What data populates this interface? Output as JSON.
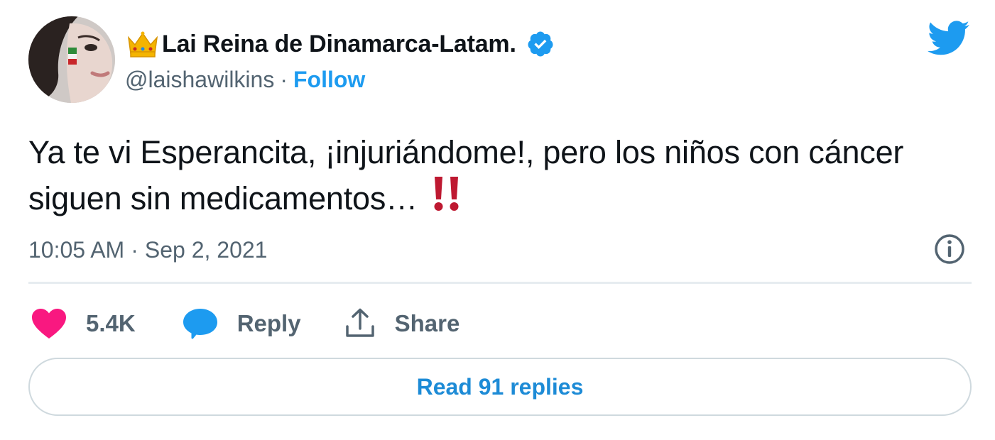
{
  "author": {
    "display_name": "Lai Reina de Dinamarca-Latam.",
    "name_emoji_icon": "crown-icon",
    "verified_icon": "verified-badge-icon",
    "handle": "@laishawilkins",
    "separator": "·",
    "follow_label": "Follow",
    "avatar_icon": "profile-photo"
  },
  "platform_logo": "twitter-bird-icon",
  "tweet": {
    "text": "Ya te vi Esperancita, ¡injuriándome!, pero los niños con cáncer siguen sin medicamentos…",
    "trailing_emoji_icon": "double-exclamation-icon",
    "time": "10:05 AM",
    "separator": "·",
    "date": "Sep 2, 2021"
  },
  "actions": {
    "like_count": "5.4K",
    "reply_label": "Reply",
    "share_label": "Share"
  },
  "read_replies_label": "Read 91 replies",
  "colors": {
    "twitter_blue": "#1d9bf0",
    "like_pink": "#f91880",
    "exclamation_red": "#be1931",
    "muted_text": "#536471"
  }
}
